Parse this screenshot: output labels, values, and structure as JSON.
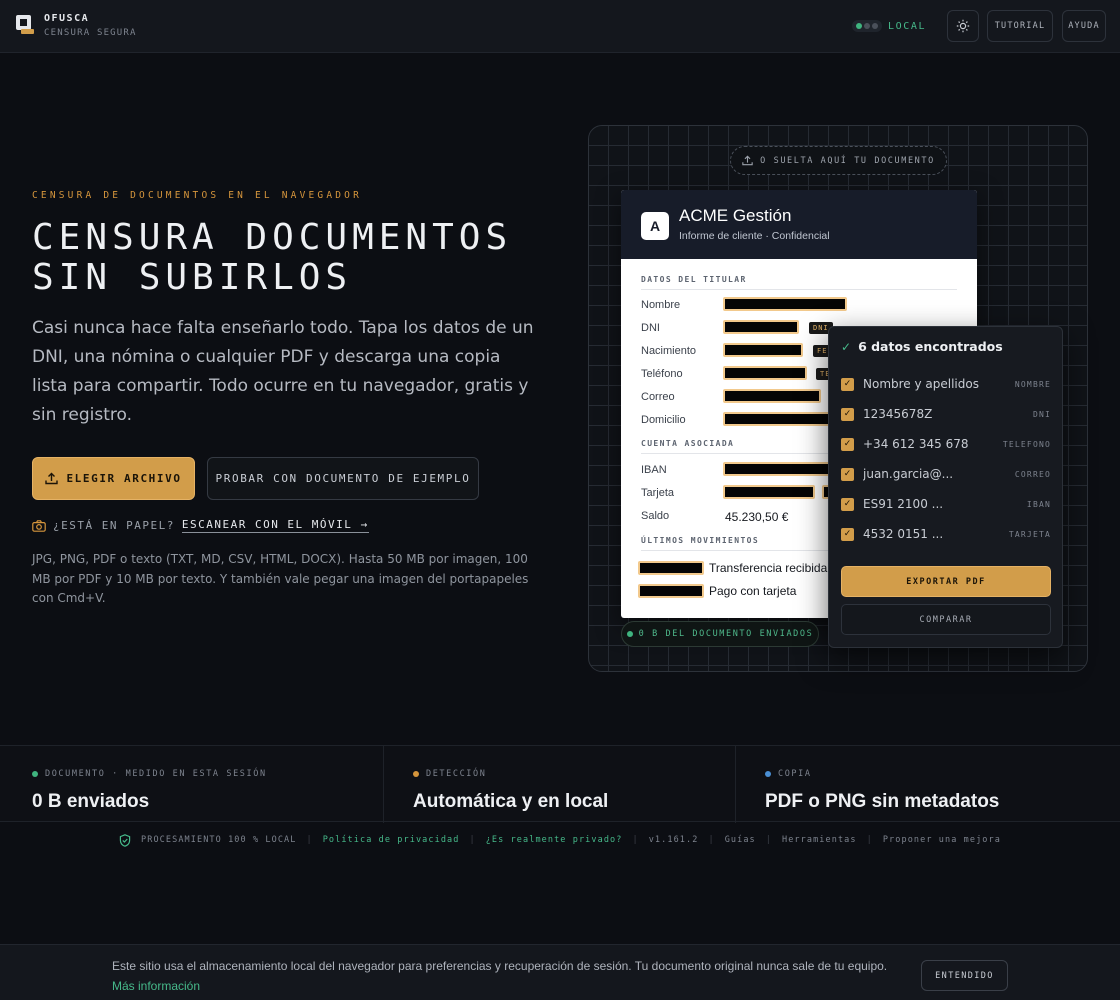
{
  "header": {
    "brand": "OFUSCA",
    "tagline": "CENSURA SEGURA",
    "status": "LOCAL",
    "tutorial": "TUTORIAL",
    "help": "AYUDA"
  },
  "hero": {
    "kicker": "CENSURA DE DOCUMENTOS EN EL NAVEGADOR",
    "title_line1": "CENSURA DOCUMENTOS",
    "title_line2": "SIN SUBIRLOS",
    "lead": "Casi nunca hace falta enseñarlo todo. Tapa los datos de un DNI, una nómina o cualquier PDF y descarga una copia lista para compartir. Todo ocurre en tu navegador, gratis y sin registro.",
    "choose_file": "ELEGIR ARCHIVO",
    "try_sample": "PROBAR CON DOCUMENTO DE EJEMPLO",
    "paper_question": "¿ESTÁ EN PAPEL?",
    "scan_link": "ESCANEAR CON EL MÓVIL →",
    "formats": "JPG, PNG, PDF o texto (TXT, MD, CSV, HTML, DOCX). Hasta 50 MB por imagen, 100 MB por PDF y 10 MB por texto. Y también vale pegar una imagen del portapapeles con Cmd+V."
  },
  "preview": {
    "drop_hint": "O SUELTA AQUÍ TU DOCUMENTO",
    "zero_sent": "0 B DEL DOCUMENTO ENVIADOS",
    "doc": {
      "avatar": "A",
      "title": "ACME Gestión",
      "subtitle": "Informe de cliente · Confidencial",
      "section_holder": "DATOS DEL TITULAR",
      "section_account": "CUENTA ASOCIADA",
      "section_movements": "ÚLTIMOS MOVIMIENTOS",
      "labels": {
        "name": "Nombre",
        "dni": "DNI",
        "birth": "Nacimiento",
        "phone": "Teléfono",
        "email": "Correo",
        "address": "Domicilio",
        "iban": "IBAN",
        "card": "Tarjeta",
        "balance": "Saldo"
      },
      "tags": {
        "dni": "DNI",
        "birth": "FE",
        "phone": "TE"
      },
      "balance_value": "45.230,50 €",
      "movement1": "Transferencia recibida",
      "movement2": "Pago con tarjeta"
    },
    "panel": {
      "title": "6 datos encontrados",
      "items": [
        {
          "value": "Nombre y apellidos",
          "type": "NOMBRE"
        },
        {
          "value": "12345678Z",
          "type": "DNI"
        },
        {
          "value": "+34 612 345 678",
          "type": "TELEFONO"
        },
        {
          "value": "juan.garcia@...",
          "type": "CORREO"
        },
        {
          "value": "ES91 2100 ...",
          "type": "IBAN"
        },
        {
          "value": "4532 0151 ...",
          "type": "TARJETA"
        }
      ],
      "export": "EXPORTAR PDF",
      "compare": "COMPARAR"
    }
  },
  "stats": [
    {
      "key": "DOCUMENTO · MEDIDO EN ESTA SESIÓN",
      "value": "0 B enviados",
      "color": "#3fb47f"
    },
    {
      "key": "DETECCIÓN",
      "value": "Automática y en local",
      "color": "#d5953c"
    },
    {
      "key": "COPIA",
      "value": "PDF o PNG sin metadatos",
      "color": "#4a8fd4"
    }
  ],
  "footer": {
    "local": "PROCESAMIENTO 100 % LOCAL",
    "privacy": "Política de privacidad",
    "really_private": "¿Es realmente privado?",
    "version": "v1.161.2",
    "guides": "Guías",
    "tools": "Herramientas",
    "suggest": "Proponer una mejora"
  },
  "cookie": {
    "text": "Este sitio usa el almacenamiento local del navegador para preferencias y recuperación de sesión. Tu documento original nunca sale de tu equipo.",
    "more": "Más información",
    "accept": "ENTENDIDO"
  },
  "colors": {
    "accent": "#d29d4a",
    "green": "#3fb47f",
    "background": "#0c0e13"
  }
}
